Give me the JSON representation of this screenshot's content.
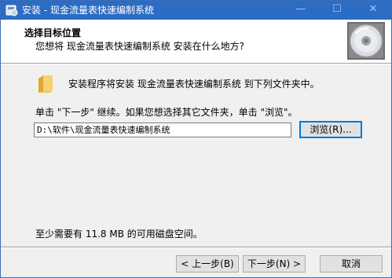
{
  "window": {
    "title": "安装 - 现金流量表快速编制系统",
    "minimize_glyph": "—",
    "maximize_glyph": "☐",
    "close_glyph": "✕",
    "title_icon": "installer-icon"
  },
  "header": {
    "title": "选择目标位置",
    "subtitle": "您想将 现金流量表快速编制系统 安装在什么地方?",
    "icon": "cd-disc-icon"
  },
  "body": {
    "folder_icon": "folder-icon",
    "install_message": "安装程序将安装 现金流量表快速编制系统 到下列文件夹中。",
    "instruction": "单击 \"下一步\" 继续。如果您想选择其它文件夹，单击 \"浏览\"。",
    "path_value": "D:\\软件\\现金流量表快速编制系统",
    "browse_label": "浏览(R)...",
    "space_required": "至少需要有 11.8 MB 的可用磁盘空间。"
  },
  "footer": {
    "back_label": "< 上一步(B)",
    "next_label": "下一步(N) >",
    "cancel_label": "取消"
  },
  "colors": {
    "titlebar": "#2b6cc4",
    "focus_border": "#0078d7",
    "folder": "#f2c14e"
  }
}
